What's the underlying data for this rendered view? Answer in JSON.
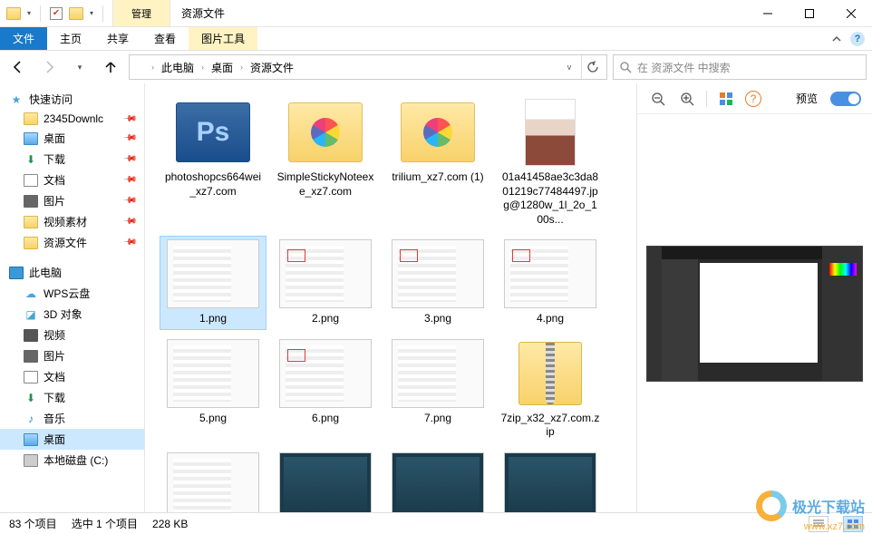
{
  "titlebar": {
    "manage_label": "管理",
    "title": "资源文件"
  },
  "ribbon": {
    "file": "文件",
    "tabs": [
      "主页",
      "共享",
      "查看"
    ],
    "context_tab": "图片工具"
  },
  "address": {
    "crumbs": [
      "此电脑",
      "桌面",
      "资源文件"
    ],
    "search_placeholder": "在 资源文件 中搜索"
  },
  "sidebar": {
    "quick_access": "快速访问",
    "quick_items": [
      {
        "label": "2345Downlc",
        "icon": "folder"
      },
      {
        "label": "桌面",
        "icon": "monitor-blue"
      },
      {
        "label": "下载",
        "icon": "download"
      },
      {
        "label": "文档",
        "icon": "document"
      },
      {
        "label": "图片",
        "icon": "picture"
      },
      {
        "label": "视频素材",
        "icon": "folder"
      },
      {
        "label": "资源文件",
        "icon": "folder"
      }
    ],
    "this_pc": "此电脑",
    "pc_items": [
      {
        "label": "WPS云盘",
        "icon": "cloud"
      },
      {
        "label": "3D 对象",
        "icon": "cube"
      },
      {
        "label": "视频",
        "icon": "film"
      },
      {
        "label": "图片",
        "icon": "picture"
      },
      {
        "label": "文档",
        "icon": "document"
      },
      {
        "label": "下载",
        "icon": "download"
      },
      {
        "label": "音乐",
        "icon": "music"
      },
      {
        "label": "桌面",
        "icon": "monitor-blue",
        "selected": true
      },
      {
        "label": "本地磁盘 (C:)",
        "icon": "disk"
      }
    ]
  },
  "files": [
    {
      "label": "photoshopcs664wei_xz7.com",
      "type": "folder-ps",
      "text": "Ps"
    },
    {
      "label": "SimpleStickyNoteexe_xz7.com",
      "type": "folder-pinwheel"
    },
    {
      "label": "trilium_xz7.com (1)",
      "type": "folder-pinwheel"
    },
    {
      "label": "01a41458ae3c3da801219c77484497.jpg@1280w_1l_2o_100s...",
      "type": "portrait"
    },
    {
      "label": "1.png",
      "type": "screenshot",
      "selected": true
    },
    {
      "label": "2.png",
      "type": "screenshot-red"
    },
    {
      "label": "3.png",
      "type": "screenshot-red"
    },
    {
      "label": "4.png",
      "type": "screenshot-red"
    },
    {
      "label": "5.png",
      "type": "screenshot"
    },
    {
      "label": "6.png",
      "type": "screenshot-red"
    },
    {
      "label": "7.png",
      "type": "screenshot"
    },
    {
      "label": "7zip_x32_xz7.com.zip",
      "type": "zip"
    },
    {
      "label": "",
      "type": "screenshot"
    },
    {
      "label": "",
      "type": "video"
    },
    {
      "label": "",
      "type": "video"
    },
    {
      "label": "",
      "type": "video"
    }
  ],
  "preview": {
    "label": "预览"
  },
  "statusbar": {
    "count": "83 个项目",
    "selection": "选中 1 个项目",
    "size": "228 KB"
  },
  "watermark": {
    "text": "极光下载站",
    "url": "www.xz7.com"
  }
}
